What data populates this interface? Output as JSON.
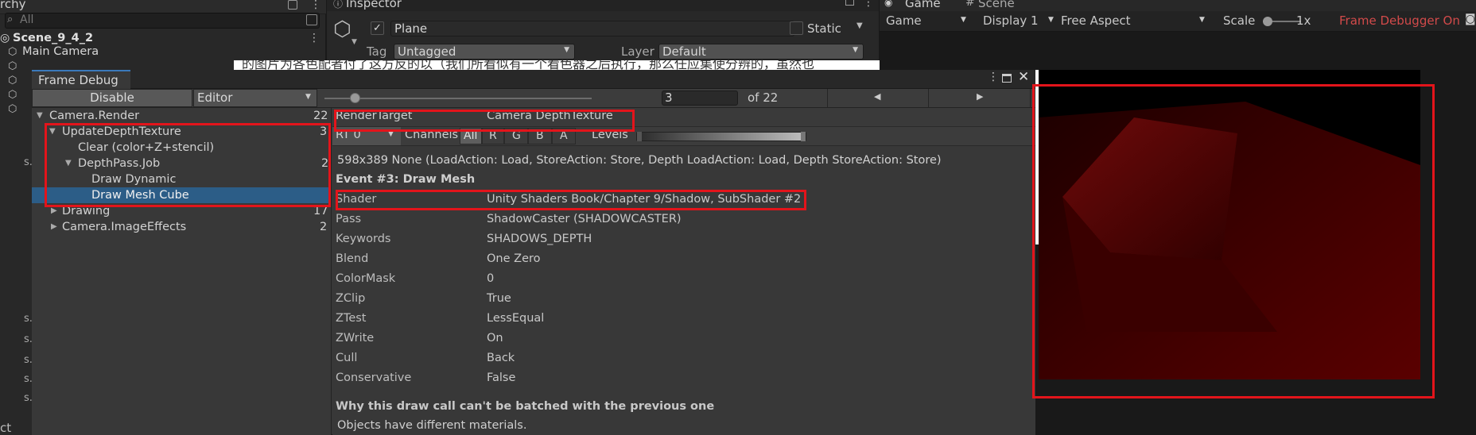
{
  "hierarchy": {
    "tab": "rchy",
    "search_placeholder": "All",
    "scene": "Scene_9_4_2",
    "items": [
      "Main Camera"
    ],
    "bottom": "ct",
    "side_marks": [
      "s.",
      "s.",
      "s.",
      "s.",
      "s.",
      "s."
    ]
  },
  "inspector": {
    "tab": "Inspector",
    "name": "Plane",
    "static_label": "Static",
    "tag_label": "Tag",
    "tag_value": "Untagged",
    "layer_label": "Layer",
    "layer_value": "Default",
    "bg_text": "的图片为各色配者付了这方反的以（我们所看似有一个看色器之后执行，那么任应集使分辨的，虽然也"
  },
  "game": {
    "tab_game": "Game",
    "tab_scene": "Scene",
    "view": "Game",
    "display": "Display 1",
    "aspect": "Free Aspect",
    "scale_label": "Scale",
    "scale_value": "1x",
    "debugger_status": "Frame Debugger On"
  },
  "frame_debug": {
    "title": "Frame Debug",
    "disable": "Disable",
    "target": "Editor",
    "event_index": "3",
    "event_total": "of 22",
    "tree": [
      {
        "label": "Camera.Render",
        "count": "22"
      },
      {
        "label": "UpdateDepthTexture",
        "count": "3"
      },
      {
        "label": "Clear (color+Z+stencil)",
        "count": ""
      },
      {
        "label": "DepthPass.Job",
        "count": "2"
      },
      {
        "label": "Draw Dynamic",
        "count": ""
      },
      {
        "label": "Draw Mesh Cube",
        "count": ""
      },
      {
        "label": "Drawing",
        "count": "17"
      },
      {
        "label": "Camera.ImageEffects",
        "count": "2"
      }
    ],
    "render_target_label": "RenderTarget",
    "render_target_value": "Camera DepthTexture",
    "rt": "RT 0",
    "channels_label": "Channels",
    "channels": [
      "All",
      "R",
      "G",
      "B",
      "A"
    ],
    "levels_label": "Levels",
    "info": "598x389 None (LoadAction: Load, StoreAction: Store, Depth LoadAction: Load, Depth StoreAction: Store)",
    "event_title": "Event #3: Draw Mesh",
    "props": [
      {
        "k": "Shader",
        "v": "Unity Shaders Book/Chapter 9/Shadow, SubShader #2"
      },
      {
        "k": "Pass",
        "v": "ShadowCaster (SHADOWCASTER)"
      },
      {
        "k": "Keywords",
        "v": "SHADOWS_DEPTH"
      },
      {
        "k": "Blend",
        "v": "One Zero"
      },
      {
        "k": "ColorMask",
        "v": "0"
      },
      {
        "k": "ZClip",
        "v": "True"
      },
      {
        "k": "ZTest",
        "v": "LessEqual"
      },
      {
        "k": "ZWrite",
        "v": "On"
      },
      {
        "k": "Cull",
        "v": "Back"
      },
      {
        "k": "Conservative",
        "v": "False"
      }
    ],
    "batch_title": "Why this draw call can't be batched with the previous one",
    "batch_reason": "Objects have different materials."
  },
  "colors": {
    "highlight": "#e3141b",
    "selection": "#2c5d87",
    "depth_red": "#6b0000"
  }
}
